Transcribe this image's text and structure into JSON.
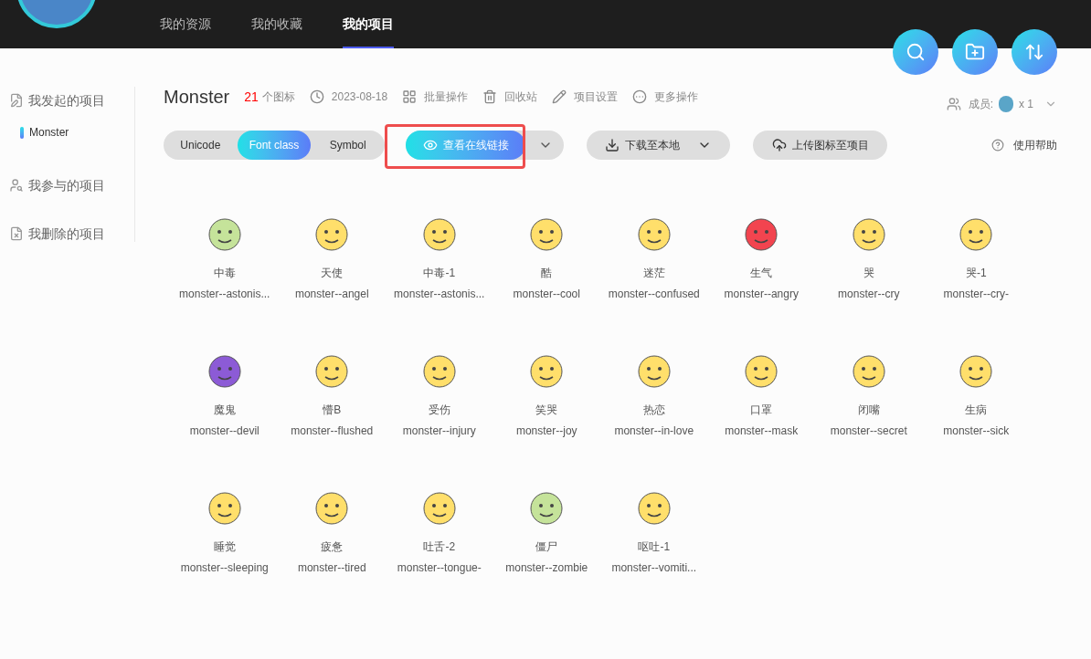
{
  "nav": {
    "tabs": [
      {
        "label": "我的资源",
        "selected": false
      },
      {
        "label": "我的收藏",
        "selected": false
      },
      {
        "label": "我的项目",
        "selected": true
      }
    ]
  },
  "sidebar": {
    "items": [
      {
        "label": "我发起的项目",
        "children": [
          {
            "label": "Monster",
            "selected": true
          }
        ]
      },
      {
        "label": "我参与的项目"
      },
      {
        "label": "我删除的项目"
      }
    ]
  },
  "project": {
    "title": "Monster",
    "count": "21",
    "count_label": "个图标",
    "date": "2023-08-18",
    "actions": [
      "批量操作",
      "回收站",
      "项目设置",
      "更多操作"
    ],
    "members_label": "成员:",
    "members_count": "x 1"
  },
  "toolbar": {
    "formats": [
      {
        "label": "Unicode",
        "selected": false
      },
      {
        "label": "Font class",
        "selected": true
      },
      {
        "label": "Symbol",
        "selected": false
      }
    ],
    "link_button": {
      "label": "查看在线链接",
      "highlighted": true
    },
    "download_button": "下载至本地",
    "upload_button": "上传图标至项目",
    "help": "使用帮助"
  },
  "icons": [
    {
      "name": "中毒",
      "code": "monster--astonis...",
      "color": "#c5e39a"
    },
    {
      "name": "天使",
      "code": "monster--angel",
      "color": "#ffdf6b"
    },
    {
      "name": "中毒-1",
      "code": "monster--astonis...",
      "color": "#ffdf6b"
    },
    {
      "name": "酷",
      "code": "monster--cool",
      "color": "#ffdf6b"
    },
    {
      "name": "迷茫",
      "code": "monster--confused",
      "color": "#ffdf6b"
    },
    {
      "name": "生气",
      "code": "monster--angry",
      "color": "#f2444f"
    },
    {
      "name": "哭",
      "code": "monster--cry",
      "color": "#ffdf6b"
    },
    {
      "name": "哭-1",
      "code": "monster--cry-",
      "color": "#ffdf6b"
    },
    {
      "name": "魔鬼",
      "code": "monster--devil",
      "color": "#8c5bd6"
    },
    {
      "name": "懵B",
      "code": "monster--flushed",
      "color": "#ffdf6b"
    },
    {
      "name": "受伤",
      "code": "monster--injury",
      "color": "#ffdf6b"
    },
    {
      "name": "笑哭",
      "code": "monster--joy",
      "color": "#ffdf6b"
    },
    {
      "name": "热恋",
      "code": "monster--in-love",
      "color": "#ffdf6b"
    },
    {
      "name": "口罩",
      "code": "monster--mask",
      "color": "#ffdf6b"
    },
    {
      "name": "闭嘴",
      "code": "monster--secret",
      "color": "#ffdf6b"
    },
    {
      "name": "生病",
      "code": "monster--sick",
      "color": "#ffdf6b"
    },
    {
      "name": "睡觉",
      "code": "monster--sleeping",
      "color": "#ffdf6b"
    },
    {
      "name": "疲惫",
      "code": "monster--tired",
      "color": "#ffdf6b"
    },
    {
      "name": "吐舌-2",
      "code": "monster--tongue-",
      "color": "#ffdf6b"
    },
    {
      "name": "僵尸",
      "code": "monster--zombie",
      "color": "#c5e39a"
    },
    {
      "name": "呕吐-1",
      "code": "monster--vomiti...",
      "color": "#ffdf6b"
    }
  ]
}
